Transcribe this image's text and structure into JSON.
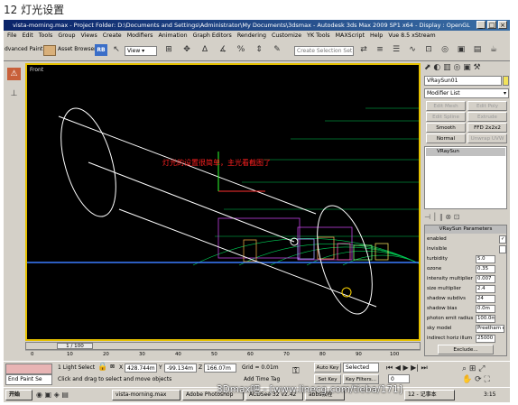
{
  "caption": "12 灯光设置",
  "window": {
    "title": "vista-morning.max    - Project Folder: D:\\Documents and Settings\\Administrator\\My Documents\\3dsmax    - Autodesk 3ds Max 2009 SP1  x64        - Display : OpenGL"
  },
  "menu": [
    "File",
    "Edit",
    "Tools",
    "Group",
    "Views",
    "Create",
    "Modifiers",
    "Animation",
    "Graph Editors",
    "Rendering",
    "Customize",
    "YK Tools",
    "MAXScript",
    "Help",
    "Vue 8.5 xStream"
  ],
  "toolbar": {
    "paint_label": "dvanced Paint",
    "asset_label": "Asset Browser",
    "rb_label": "RB",
    "view_select": "View",
    "selection_set_placeholder": "Create Selection Set"
  },
  "viewport": {
    "label": "Front",
    "annotation": "灯光的设置很简单，主光看截图了"
  },
  "command_panel": {
    "object_name": "VRaySun01",
    "modifier_list": "Modifier List",
    "buttons": [
      "Edit Mesh",
      "Edit Poly",
      "Edit Spline",
      "Extrude",
      "Smooth",
      "FFD 2x2x2",
      "Normal",
      "Unwrap UVW"
    ],
    "stack_item": "VRaySun",
    "rollout_title": "VRaySun Parameters",
    "params": [
      {
        "label": "enabled",
        "value": "✓"
      },
      {
        "label": "invisible",
        "value": ""
      },
      {
        "label": "turbidity",
        "value": "5.0"
      },
      {
        "label": "ozone",
        "value": "0.35"
      },
      {
        "label": "intensity multiplier",
        "value": "0.007"
      },
      {
        "label": "size multiplier",
        "value": "2.4"
      },
      {
        "label": "shadow subdivs",
        "value": "24"
      },
      {
        "label": "shadow bias",
        "value": "0.0m"
      },
      {
        "label": "photon emit radius",
        "value": "100.0m"
      },
      {
        "label": "sky model",
        "value": "Preetham et"
      },
      {
        "label": "indirect horiz illum",
        "value": "25000"
      }
    ],
    "exclude": "Exclude..."
  },
  "timeline": {
    "frame": "1 / 100",
    "ticks": [
      "0",
      "10",
      "20",
      "30",
      "40",
      "50",
      "60",
      "70",
      "80",
      "90",
      "100"
    ]
  },
  "status": {
    "end_paint": "End Paint Se",
    "selection": "1 Light Select",
    "prompt": "Click and drag to select and move objects",
    "x_value": "428.744m",
    "y_value": "-99.134m",
    "z_value": "166.07m",
    "grid": "Grid = 0.01m",
    "auto_key": "Auto Key",
    "selected": "Selected",
    "set_key": "Set Key",
    "key_filters": "Key Filters...",
    "add_time_tag": "Add Time Tag",
    "frame_value": "0"
  },
  "taskbar": {
    "start": "开始",
    "items": [
      "vista-morning.max",
      "Adobe Photoshop",
      "ACDSee 32 v2.42",
      "abbs教程",
      "12 - 记事本"
    ],
    "clock": "3:15"
  },
  "watermark": "3Dmax吧 - [www.linecg.com/tieba/171]",
  "colors": {
    "title_start": "#0a246a",
    "title_end": "#3a6ea5",
    "viewport_border": "#e5c000",
    "viewport_bg": "#000000",
    "dome": "#00cc55",
    "light_cylinder": "#ffffff",
    "annotation": "#ff2020"
  }
}
